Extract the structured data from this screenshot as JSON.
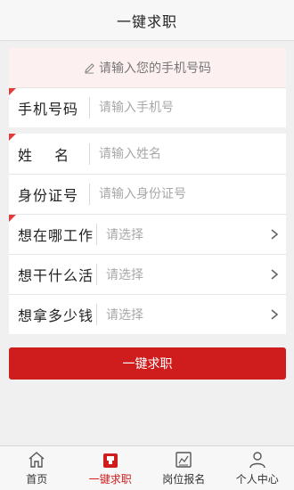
{
  "header": {
    "title": "一键求职"
  },
  "phone_section": {
    "notice": "请输入您的手机号码",
    "label": "手机号码",
    "placeholder": "请输入手机号"
  },
  "identity_section": {
    "name_label": "姓 名",
    "name_placeholder": "请输入姓名",
    "id_label": "身份证号",
    "id_placeholder": "请输入身份证号",
    "where_label": "想在哪工作",
    "where_value": "请选择",
    "job_label": "想干什么活",
    "job_value": "请选择",
    "salary_label": "想拿多少钱",
    "salary_value": "请选择"
  },
  "submit_label": "一键求职",
  "tabbar": {
    "items": [
      {
        "label": "首页",
        "icon": "home-icon"
      },
      {
        "label": "一键求职",
        "icon": "briefcase-icon"
      },
      {
        "label": "岗位报名",
        "icon": "form-icon"
      },
      {
        "label": "个人中心",
        "icon": "user-icon"
      }
    ],
    "active_index": 1
  },
  "colors": {
    "accent": "#cf1d1d",
    "notice_bg": "#fdf0f0",
    "corner_mark": "#e03c3c"
  }
}
